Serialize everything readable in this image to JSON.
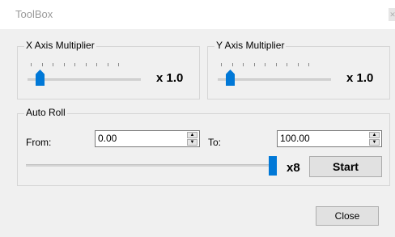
{
  "window": {
    "title": "ToolBox"
  },
  "x_axis": {
    "label": "X Axis Multiplier",
    "value_text": "x 1.0",
    "slider_fraction": 0.1
  },
  "y_axis": {
    "label": "Y Axis Multiplier",
    "value_text": "x 1.0",
    "slider_fraction": 0.1
  },
  "auto_roll": {
    "label": "Auto Roll",
    "from_label": "From:",
    "from_value": "0.00",
    "to_label": "To:",
    "to_value": "100.00",
    "speed_text": "x8",
    "speed_fraction": 1.0,
    "start_label": "Start"
  },
  "footer": {
    "close_label": "Close"
  },
  "colors": {
    "accent": "#0078d7",
    "background": "#f0f0f0"
  }
}
